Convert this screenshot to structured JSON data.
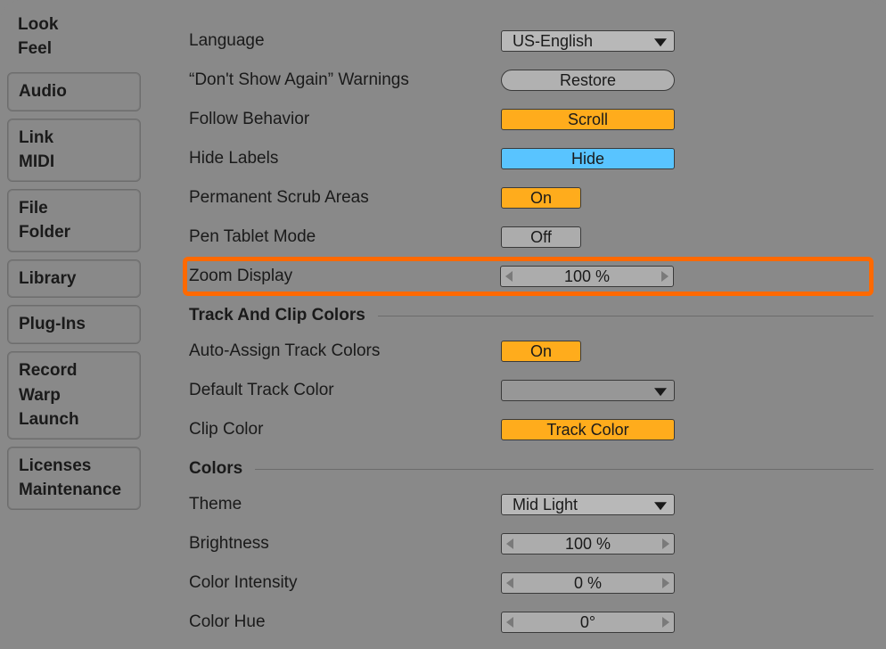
{
  "sidebar": {
    "active": [
      "Look",
      "Feel"
    ],
    "tabs": [
      [
        "Audio"
      ],
      [
        "Link",
        "MIDI"
      ],
      [
        "File",
        "Folder"
      ],
      [
        "Library"
      ],
      [
        "Plug-Ins"
      ],
      [
        "Record",
        "Warp",
        "Launch"
      ],
      [
        "Licenses",
        "Maintenance"
      ]
    ]
  },
  "settings": {
    "language": {
      "label": "Language",
      "value": "US-English"
    },
    "warnings": {
      "label": "“Don't Show Again” Warnings",
      "button": "Restore"
    },
    "follow": {
      "label": "Follow Behavior",
      "value": "Scroll"
    },
    "hide": {
      "label": "Hide Labels",
      "value": "Hide"
    },
    "scrub": {
      "label": "Permanent Scrub Areas",
      "value": "On"
    },
    "pen": {
      "label": "Pen Tablet Mode",
      "value": "Off"
    },
    "zoom": {
      "label": "Zoom Display",
      "value": "100 %"
    }
  },
  "sections": {
    "track_colors": "Track And Clip Colors",
    "colors": "Colors"
  },
  "trackColors": {
    "auto": {
      "label": "Auto-Assign Track Colors",
      "value": "On"
    },
    "default": {
      "label": "Default Track Color",
      "value": ""
    },
    "clip": {
      "label": "Clip Color",
      "value": "Track Color"
    }
  },
  "colors": {
    "theme": {
      "label": "Theme",
      "value": "Mid Light"
    },
    "brightness": {
      "label": "Brightness",
      "value": "100 %"
    },
    "intensity": {
      "label": "Color Intensity",
      "value": "0 %"
    },
    "hue": {
      "label": "Color Hue",
      "value": "0°"
    }
  }
}
